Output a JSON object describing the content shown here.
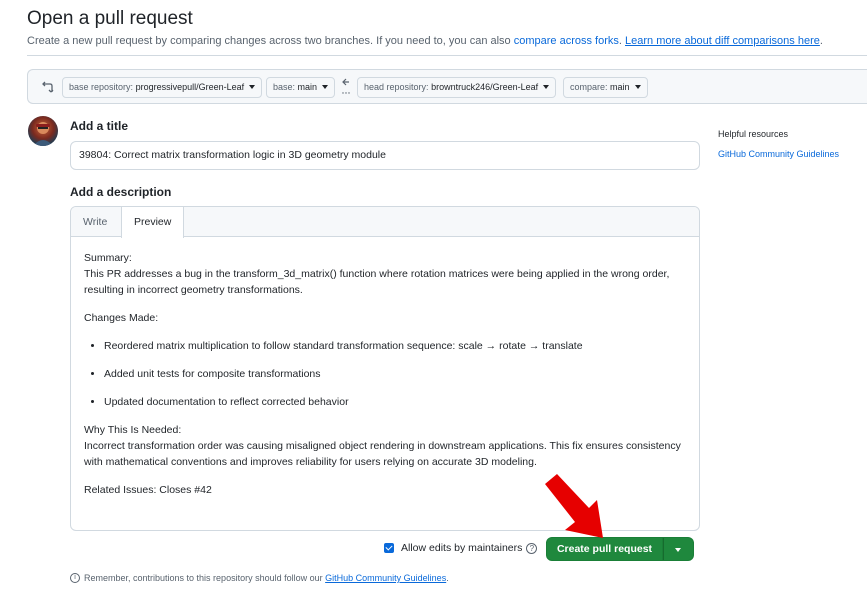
{
  "header": {
    "title": "Open a pull request",
    "subtitle_text": "Create a new pull request by comparing changes across two branches. If you need to, you can also",
    "compare_forks_link": "compare across forks",
    "learn_more_link": "Learn more about diff comparisons here"
  },
  "compare_bar": {
    "base_repo_label": "base repository:",
    "base_repo_value": "progressivepull/Green-Leaf",
    "base_label": "base:",
    "base_value": "main",
    "head_repo_label": "head repository:",
    "head_repo_value": "browntruck246/Green-Leaf",
    "compare_label": "compare:",
    "compare_value": "main"
  },
  "form": {
    "title_label": "Add a title",
    "title_value": "39804: Correct matrix transformation logic in 3D geometry module",
    "description_label": "Add a description",
    "tabs": [
      {
        "label": "Write"
      },
      {
        "label": "Preview"
      }
    ],
    "active_tab": "Preview"
  },
  "preview": {
    "summary_heading": "Summary:",
    "summary_text": "This PR addresses a bug in the transform_3d_matrix() function where rotation matrices were being applied in the wrong order, resulting in incorrect geometry transformations.",
    "changes_heading": "Changes Made:",
    "changes": [
      "Reordered matrix multiplication to follow standard transformation sequence: scale → rotate → translate",
      "Added unit tests for composite transformations",
      "Updated documentation to reflect corrected behavior"
    ],
    "why_heading": "Why This Is Needed:",
    "why_text": "Incorrect transformation order was causing misaligned object rendering in downstream applications. This fix ensures consistency with mathematical conventions and improves reliability for users relying on accurate 3D modeling.",
    "related_label": "Related Issues: Closes #42"
  },
  "sidebar": {
    "title": "Helpful resources",
    "link": "GitHub Community Guidelines"
  },
  "actions": {
    "allow_edits_label": "Allow edits by maintainers",
    "allow_edits_checked": true,
    "create_button_label": "Create pull request"
  },
  "footer": {
    "note_text": "Remember, contributions to this repository should follow our",
    "note_link": "GitHub Community Guidelines",
    "note_end": "."
  },
  "colors": {
    "primary_green": "#1f883d",
    "link_blue": "#0969da",
    "annotation_red": "#e60000"
  }
}
